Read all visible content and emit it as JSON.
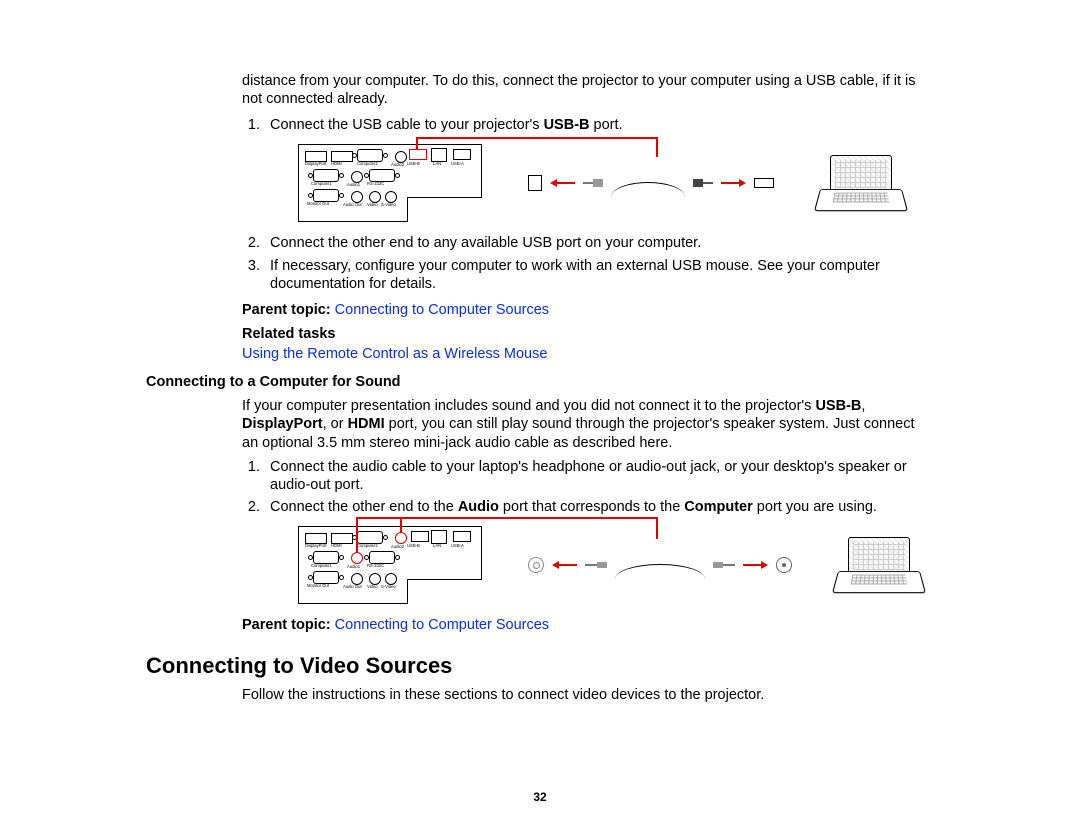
{
  "intro_continuation": "distance from your computer. To do this, connect the projector to your computer using a USB cable, if it is not connected already.",
  "steps_a": {
    "s1_pre": "Connect the USB cable to your projector's ",
    "s1_bold": "USB-B",
    "s1_post": " port.",
    "s2": "Connect the other end to any available USB port on your computer.",
    "s3": "If necessary, configure your computer to work with an external USB mouse. See your computer documentation for details."
  },
  "parent_topic_label": "Parent topic: ",
  "parent_topic_link": "Connecting to Computer Sources",
  "related_tasks_label": "Related tasks",
  "related_task_link": "Using the Remote Control as a Wireless Mouse",
  "section_sound_heading": "Connecting to a Computer for Sound",
  "sound_intro": {
    "p1": "If your computer presentation includes sound and you did not connect it to the projector's ",
    "b1": "USB-B",
    "p2": ", ",
    "b2": "DisplayPort",
    "p3": ", or ",
    "b3": "HDMI",
    "p4": " port, you can still play sound through the projector's speaker system. Just connect an optional 3.5 mm stereo mini-jack audio cable as described here."
  },
  "steps_b": {
    "s1": "Connect the audio cable to your laptop's headphone or audio-out jack, or your desktop's speaker or audio-out port.",
    "s2_pre": "Connect the other end to the ",
    "s2_b1": "Audio",
    "s2_mid": " port that corresponds to the ",
    "s2_b2": "Computer",
    "s2_post": " port you are using."
  },
  "heading_video": "Connecting to Video Sources",
  "video_intro": "Follow the instructions in these sections to connect video devices to the projector.",
  "page_number": "32",
  "panel_labels": {
    "hdmi": "HDMI",
    "displayport": "DisplayPort",
    "computer1": "Computer1",
    "computer2": "Computer2",
    "audio1": "Audio1",
    "audio2": "Audio2",
    "rs232": "RS-232C",
    "usbb": "USB-B",
    "lan": "LAN",
    "usba": "USB-A",
    "monitorout": "Monitor Out",
    "audioout": "Audio Out",
    "video": "Video",
    "svideo": "S-Video"
  }
}
